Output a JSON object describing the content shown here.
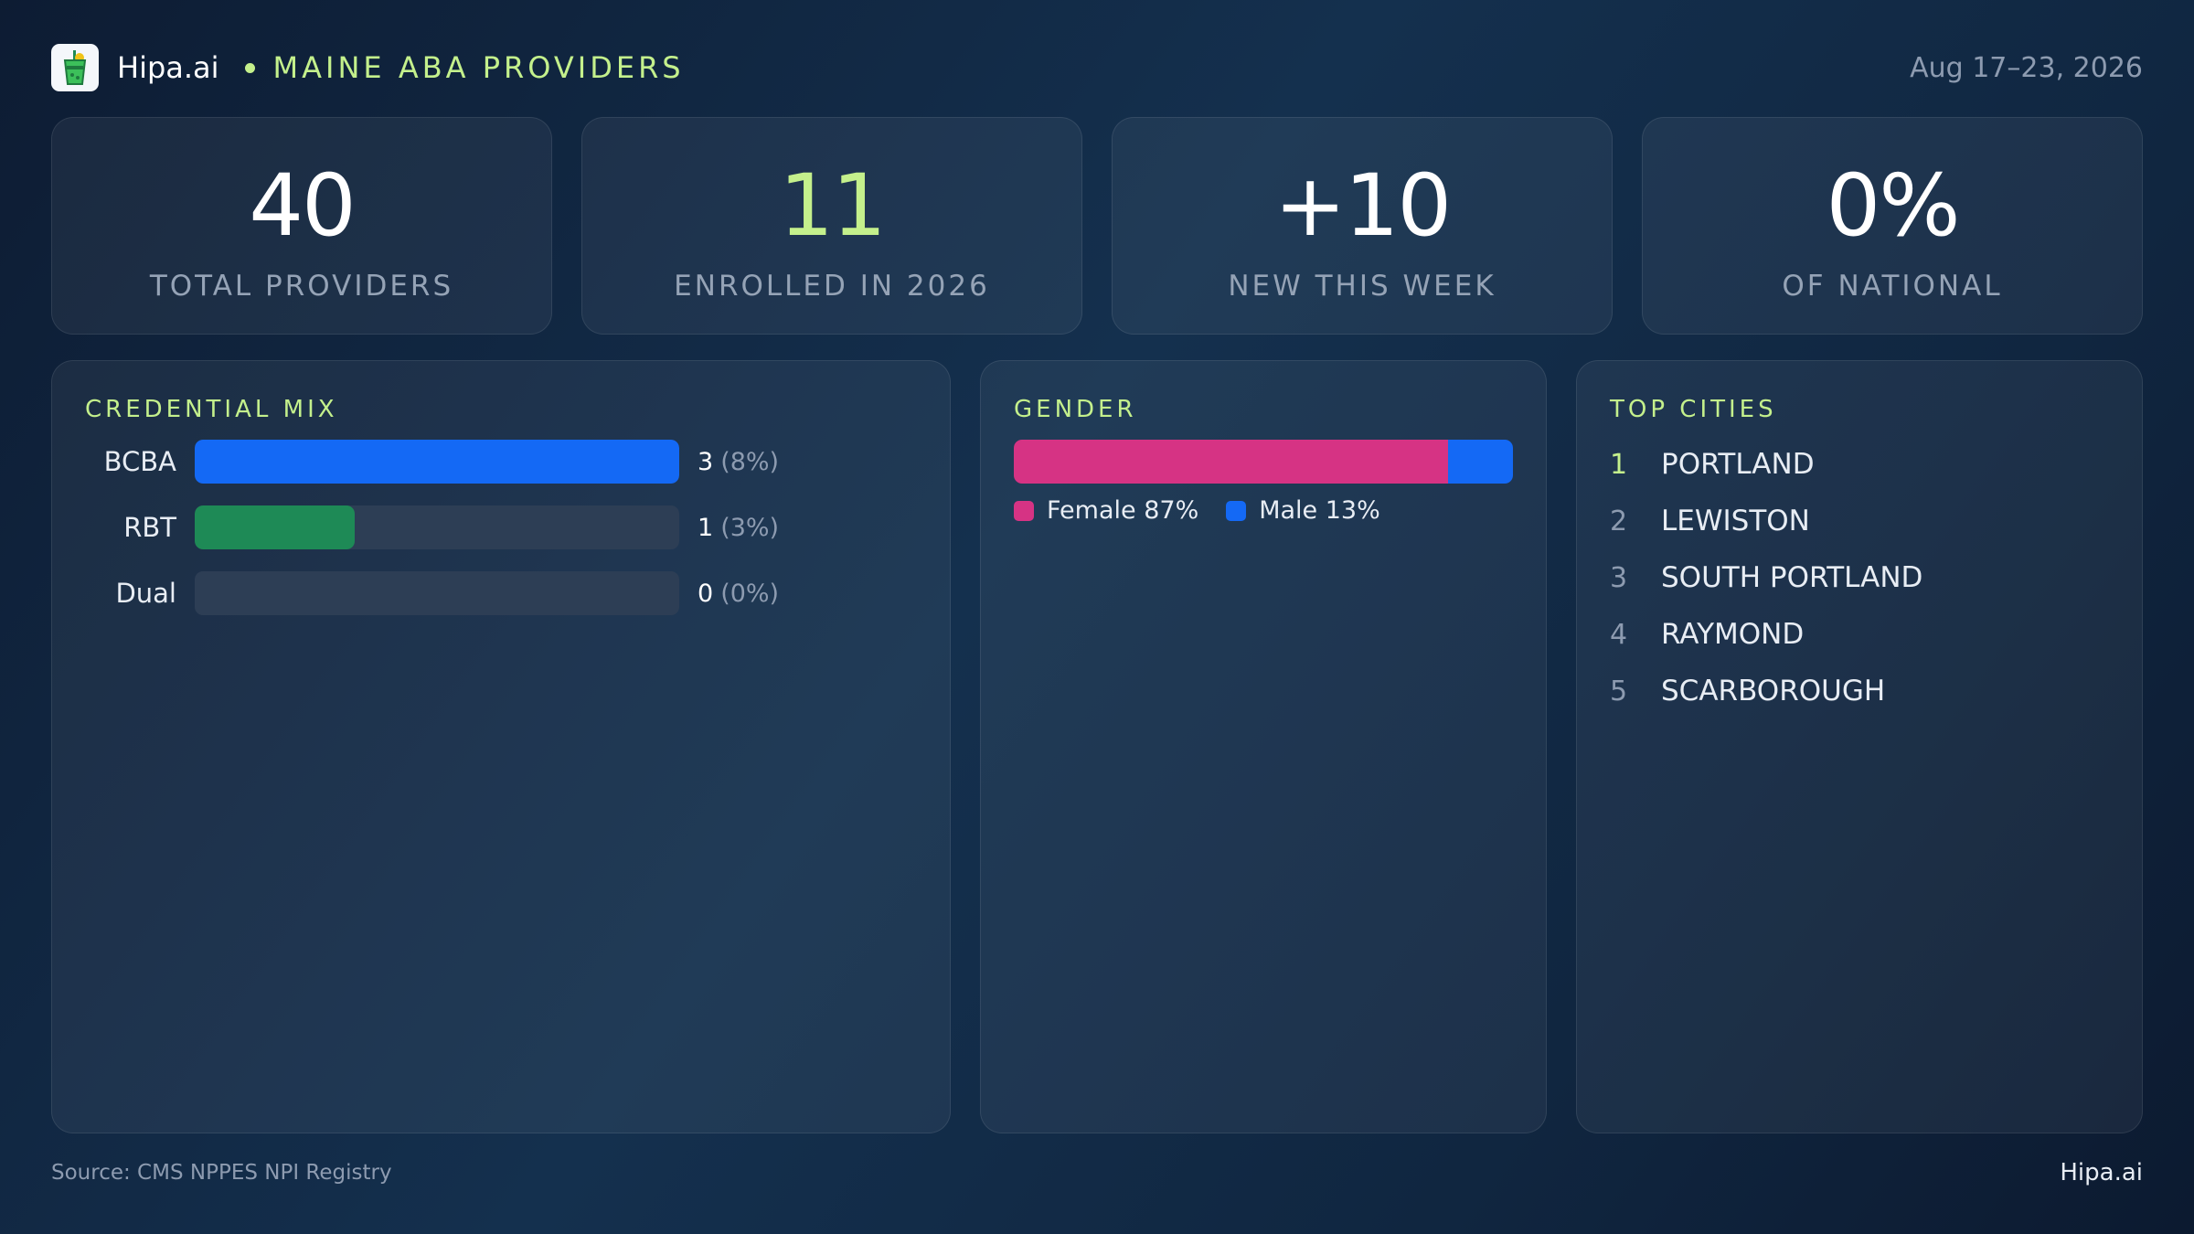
{
  "header": {
    "brand": "Hipa.ai",
    "title": "MAINE ABA PROVIDERS",
    "date_range": "Aug 17–23, 2026"
  },
  "stats": [
    {
      "value": "40",
      "label": "TOTAL PROVIDERS"
    },
    {
      "value": "11",
      "label": "ENROLLED IN 2026"
    },
    {
      "value": "+10",
      "label": "NEW THIS WEEK"
    },
    {
      "value": "0%",
      "label": "OF NATIONAL"
    }
  ],
  "credential_mix": {
    "title": "CREDENTIAL MIX",
    "rows": [
      {
        "label": "BCBA",
        "count": "3",
        "pct": "(8%)",
        "fill": 1.0,
        "color": "#1469f5"
      },
      {
        "label": "RBT",
        "count": "1",
        "pct": "(3%)",
        "fill": 0.33,
        "color": "#1e8a56"
      },
      {
        "label": "Dual",
        "count": "0",
        "pct": "(0%)",
        "fill": 0.0,
        "color": "#1469f5"
      }
    ]
  },
  "gender": {
    "title": "GENDER",
    "segments": [
      {
        "label": "Female 87%",
        "share": 87,
        "color": "#d63384"
      },
      {
        "label": "Male 13%",
        "share": 13,
        "color": "#1469f5"
      }
    ]
  },
  "top_cities": {
    "title": "TOP CITIES",
    "items": [
      {
        "rank": "1",
        "name": "PORTLAND"
      },
      {
        "rank": "2",
        "name": "LEWISTON"
      },
      {
        "rank": "3",
        "name": "SOUTH PORTLAND"
      },
      {
        "rank": "4",
        "name": "RAYMOND"
      },
      {
        "rank": "5",
        "name": "SCARBOROUGH"
      }
    ]
  },
  "footer": {
    "source": "Source: CMS NPPES NPI Registry",
    "brand": "Hipa.ai"
  },
  "colors": {
    "accent": "#c4f08c",
    "muted": "#8d9bb0"
  }
}
